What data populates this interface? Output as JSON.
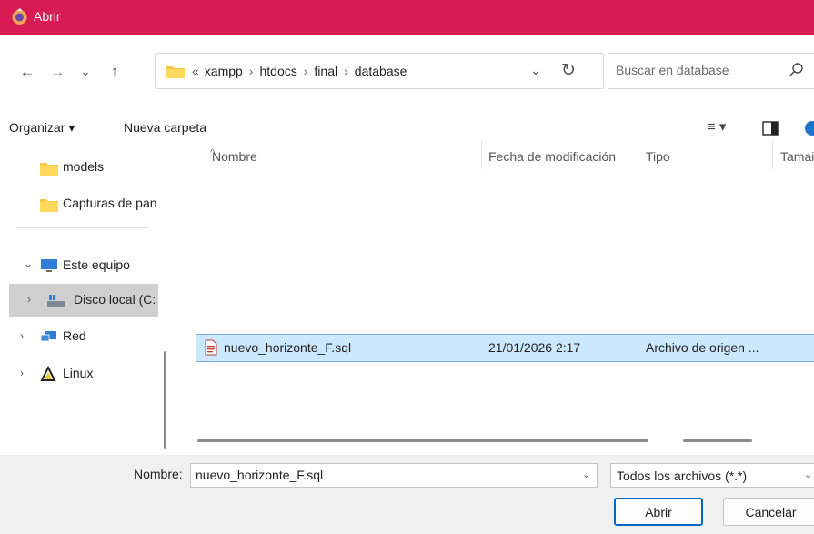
{
  "window": {
    "title": "Abrir",
    "app_icon": "app-icon"
  },
  "nav": {
    "back_icon": "arrow-left-icon",
    "forward_icon": "arrow-right-icon",
    "recent_icon": "chevron-down-icon",
    "up_icon": "arrow-up-icon",
    "breadcrumb": [
      "«",
      "xampp",
      "htdocs",
      "final",
      "database"
    ],
    "refresh_icon": "refresh-icon",
    "search_placeholder": "Buscar en database"
  },
  "commandbar": {
    "organize": "Organizar ▾",
    "new_folder": "Nueva carpeta"
  },
  "sidebar": {
    "items": [
      {
        "label": "models",
        "icon": "folder-icon"
      },
      {
        "label": "Capturas de pan",
        "icon": "folder-icon"
      },
      {
        "label": "Este equipo",
        "icon": "computer-icon",
        "chevron": "⌄"
      },
      {
        "label": "Disco local (C:",
        "icon": "drive-icon",
        "chevron": "›"
      },
      {
        "label": "Red",
        "icon": "network-icon",
        "chevron": "›"
      },
      {
        "label": "Linux",
        "icon": "linux-icon",
        "chevron": "›"
      }
    ]
  },
  "columns": {
    "name": "Nombre",
    "date": "Fecha de modificación",
    "type": "Tipo",
    "size": "Tamai"
  },
  "files": [
    {
      "name": "nuevo_horizonte_F.sql",
      "date": "21/01/2026 2:17",
      "type": "Archivo de origen ..."
    }
  ],
  "footer": {
    "name_label": "Nombre:",
    "name_value": "nuevo_horizonte_F.sql",
    "file_type": "Todos los archivos (*.*)",
    "open_button": "Abrir",
    "cancel_button": "Cancelar"
  },
  "colors": {
    "titlebar": "#d81b55",
    "selection": "#cce8ff",
    "accent": "#0067c0"
  }
}
